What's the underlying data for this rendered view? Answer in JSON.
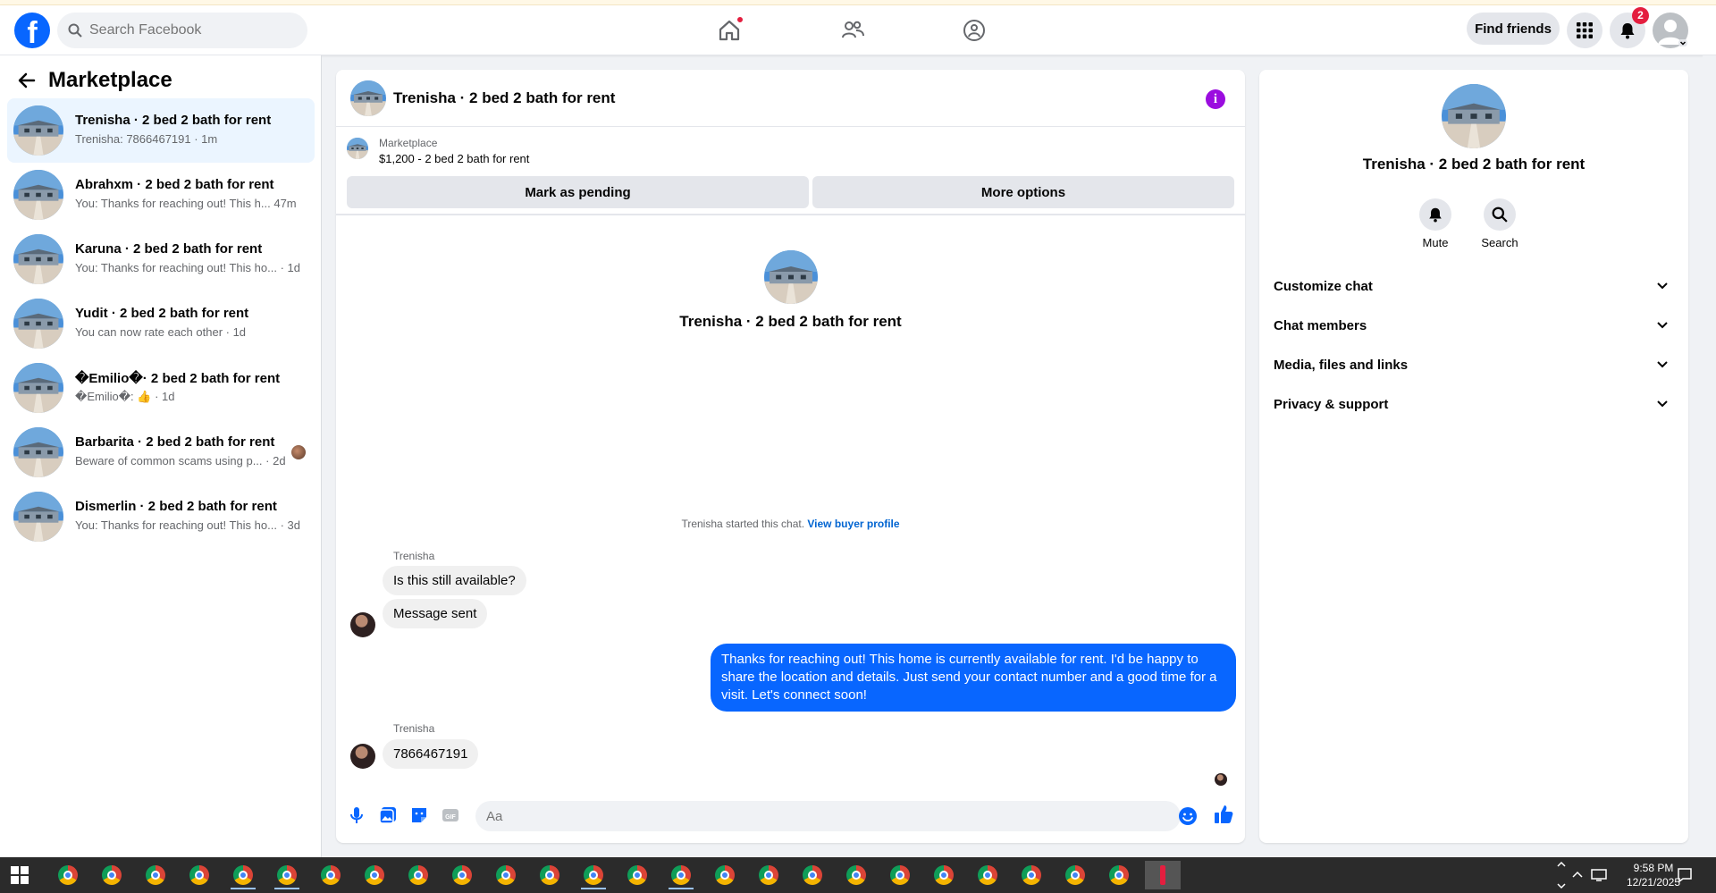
{
  "topbar": {
    "logo_letter": "f",
    "search_placeholder": "Search Facebook",
    "find_friends_label": "Find friends",
    "notification_count": "2"
  },
  "sidebar": {
    "title": "Marketplace",
    "conversations": [
      {
        "name": "Trenisha · 2 bed 2 bath for rent",
        "preview": "Trenisha: 7866467191 · 1m",
        "active": true
      },
      {
        "name": "Abrahxm · 2 bed 2 bath for rent",
        "preview": "You: Thanks for reaching out! This h...  47m"
      },
      {
        "name": "Karuna · 2 bed 2 bath for rent",
        "preview": "You: Thanks for reaching out! This ho...  · 1d"
      },
      {
        "name": "Yudit · 2 bed 2 bath for rent",
        "preview": "You can now rate each other · 1d"
      },
      {
        "name": "�Emilio�· 2 bed 2 bath for rent",
        "preview": "�Emilio�: 👍 · 1d"
      },
      {
        "name": "Barbarita · 2 bed 2 bath for rent",
        "preview": "Beware of common scams using p...  · 2d"
      },
      {
        "name": "Dismerlin · 2 bed 2 bath for rent",
        "preview": "You: Thanks for reaching out! This ho...  · 3d"
      }
    ]
  },
  "chat": {
    "title": "Trenisha · 2 bed 2 bath for rent",
    "listing": {
      "source": "Marketplace",
      "price_title": "$1,200 - 2 bed 2 bath for rent"
    },
    "mark_pending_label": "Mark as pending",
    "more_options_label": "More options",
    "intro_name": "Trenisha · 2 bed 2 bath for rent",
    "started_text": "Trenisha started this chat. ",
    "view_buyer_profile": "View buyer profile",
    "messages": [
      {
        "sender": "Trenisha",
        "text": "Is this still available?"
      },
      {
        "text": "Message sent"
      },
      {
        "direction": "out",
        "text": "Thanks for reaching out! This home is currently available for rent. I'd be happy to share the location and details. Just send your contact number and a good time for a visit. Let's connect soon!"
      },
      {
        "sender": "Trenisha",
        "text": "7866467191"
      }
    ],
    "composer_placeholder": "Aa"
  },
  "details": {
    "name": "Trenisha · 2 bed 2 bath for rent",
    "mute_label": "Mute",
    "search_label": "Search",
    "sections": [
      "Customize chat",
      "Chat members",
      "Media, files and links",
      "Privacy & support"
    ]
  },
  "taskbar": {
    "time": "9:58 PM",
    "date": "12/21/2025"
  },
  "colors": {
    "brand_blue": "#0866ff",
    "outgoing_bubble": "#0866ff",
    "info_purple": "#9b0ddf",
    "badge_red": "#e41e3f"
  }
}
